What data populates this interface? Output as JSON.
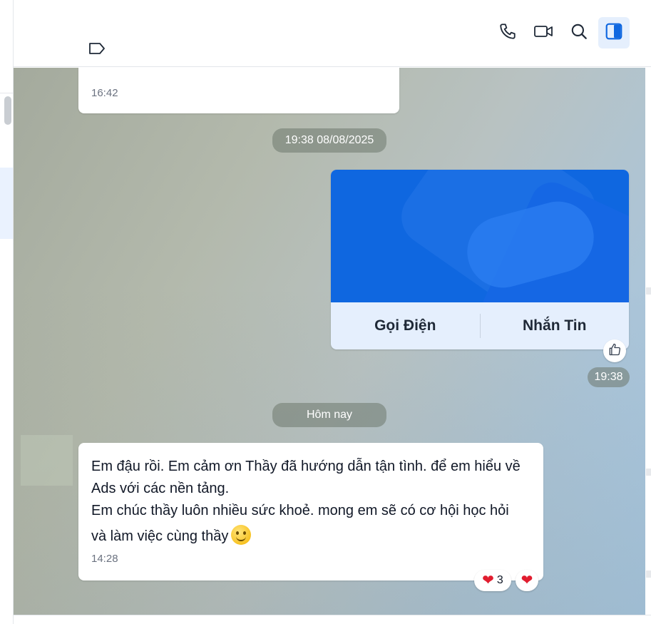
{
  "header": {
    "icons": [
      "label-tag-icon",
      "phone-icon",
      "video-call-icon",
      "search-icon",
      "side-panel-toggle-icon"
    ],
    "accent_color": "#0f67e0"
  },
  "conversation": {
    "previous_message": {
      "clipped_text": "···· ··· ·· ···· ······ ·· ···· ··· ·· ····· · ·····",
      "time": "16:42"
    },
    "date_separator_1": "19:38 08/08/2025",
    "contact_card": {
      "call_label": "Gọi Điện",
      "message_label": "Nhắn Tin",
      "time": "19:38"
    },
    "date_separator_2": "Hôm nay",
    "incoming_message": {
      "lines": [
        "Em đậu rồi. Em cảm ơn Thầy đã hướng dẫn tận tình. để em hiểu về",
        "Ads với các nền tảng.",
        "Em chúc thầy luôn nhiều sức khoẻ. mong em sẽ có cơ hội học hỏi",
        "và làm việc cùng thầy"
      ],
      "time": "14:28",
      "reaction_count": "3"
    }
  }
}
